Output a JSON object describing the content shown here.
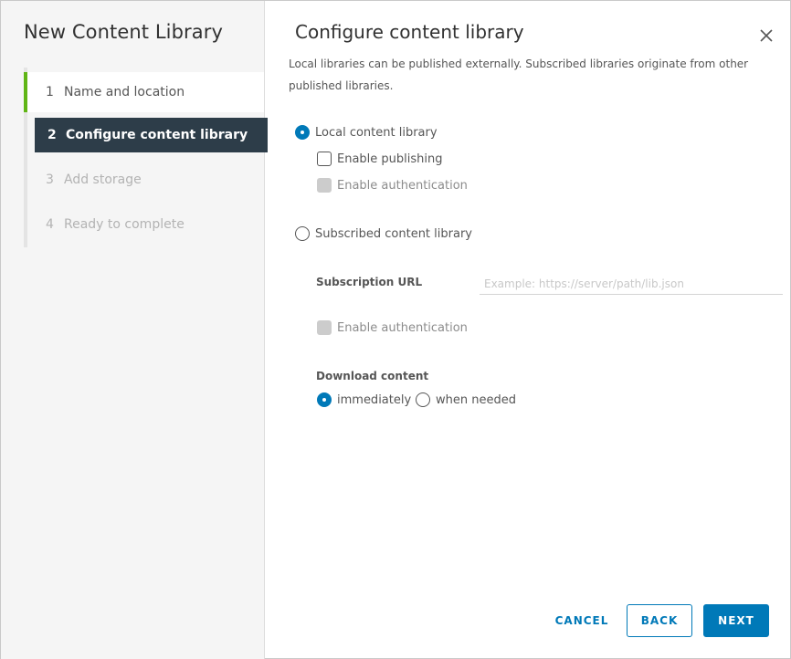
{
  "wizard": {
    "title": "New Content Library",
    "steps": [
      {
        "num": "1",
        "label": "Name and location",
        "state": "completed"
      },
      {
        "num": "2",
        "label": "Configure content library",
        "state": "current"
      },
      {
        "num": "3",
        "label": "Add storage",
        "state": "disabled"
      },
      {
        "num": "4",
        "label": "Ready to complete",
        "state": "disabled"
      }
    ]
  },
  "content": {
    "title": "Configure content library",
    "intro": "Local libraries can be published externally. Subscribed libraries originate from other published libraries.",
    "local_option": {
      "label": "Local content library",
      "selected": true
    },
    "enable_publishing": {
      "label": "Enable publishing",
      "checked": false
    },
    "local_enable_auth": {
      "label": "Enable authentication",
      "checked": false,
      "disabled": true
    },
    "subscribed_option": {
      "label": "Subscribed content library",
      "selected": false
    },
    "subscription_url": {
      "label": "Subscription URL",
      "value": "",
      "placeholder": "Example: https://server/path/lib.json"
    },
    "subscribed_enable_auth": {
      "label": "Enable authentication",
      "checked": false,
      "disabled": true
    },
    "download_content": {
      "label": "Download content",
      "options": [
        {
          "label": "immediately",
          "selected": true
        },
        {
          "label": "when needed",
          "selected": false
        }
      ]
    }
  },
  "footer": {
    "cancel_label": "CANCEL",
    "back_label": "BACK",
    "next_label": "NEXT"
  },
  "colors": {
    "accent": "#0079b8",
    "completed": "#60b515",
    "current_step_bg": "#2d3d49"
  }
}
